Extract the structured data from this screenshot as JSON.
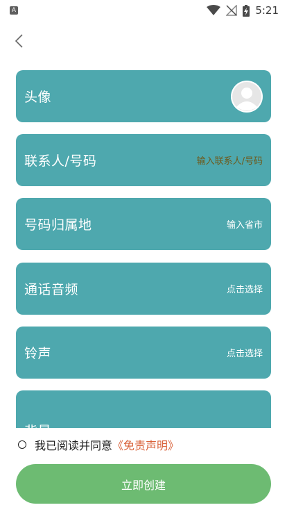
{
  "status_bar": {
    "time": "5:21",
    "app_letter": "A"
  },
  "rows": [
    {
      "label": "头像",
      "hint": ""
    },
    {
      "label": "联系人/号码",
      "hint": "输入联系人/号码"
    },
    {
      "label": "号码归属地",
      "hint": "输入省市"
    },
    {
      "label": "通话音频",
      "hint": "点击选择"
    },
    {
      "label": "铃声",
      "hint": "点击选择"
    },
    {
      "label": "背景",
      "hint": ""
    }
  ],
  "agreement": {
    "text": "我已阅读并同意",
    "link": "《免责声明》"
  },
  "create_button": {
    "label": "立即创建"
  },
  "colors": {
    "row_bg": "#4ea8ae",
    "button_bg": "#6dbb72",
    "link": "#d9623a"
  }
}
